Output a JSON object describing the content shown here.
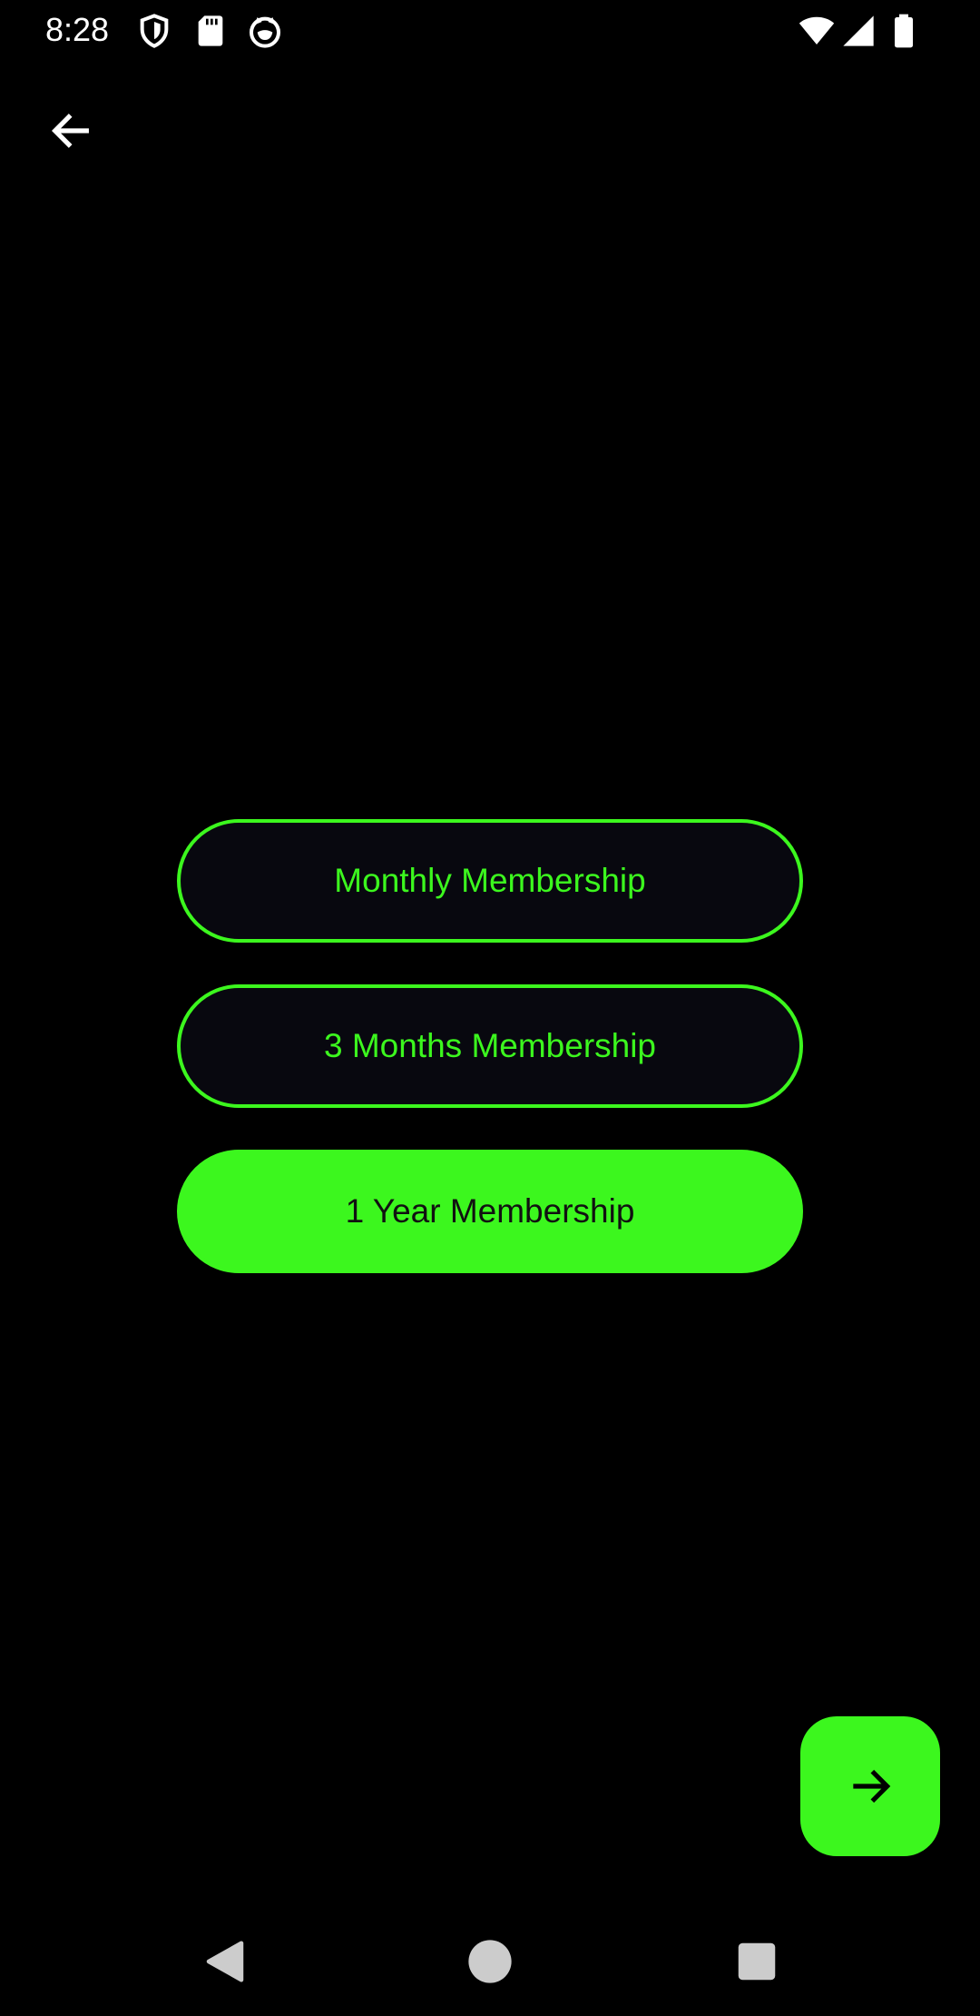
{
  "status_bar": {
    "time": "8:28",
    "left_icons": [
      "shield-icon",
      "sd-card-icon",
      "face-icon"
    ],
    "right_icons": [
      "wifi-icon",
      "cellular-signal-icon",
      "battery-icon"
    ]
  },
  "header": {
    "back_icon": "arrow-left-icon"
  },
  "membership_options": [
    {
      "label": "Monthly Membership",
      "selected": false
    },
    {
      "label": "3 Months Membership",
      "selected": false
    },
    {
      "label": "1 Year Membership",
      "selected": true
    }
  ],
  "fab": {
    "icon": "arrow-right-icon"
  },
  "nav_bar": {
    "items": [
      "back-triangle-icon",
      "home-circle-icon",
      "recents-square-icon"
    ]
  },
  "colors": {
    "background": "#000000",
    "accent": "#3cf71e",
    "outline_fill": "#08080f",
    "text_dark": "#111111"
  }
}
